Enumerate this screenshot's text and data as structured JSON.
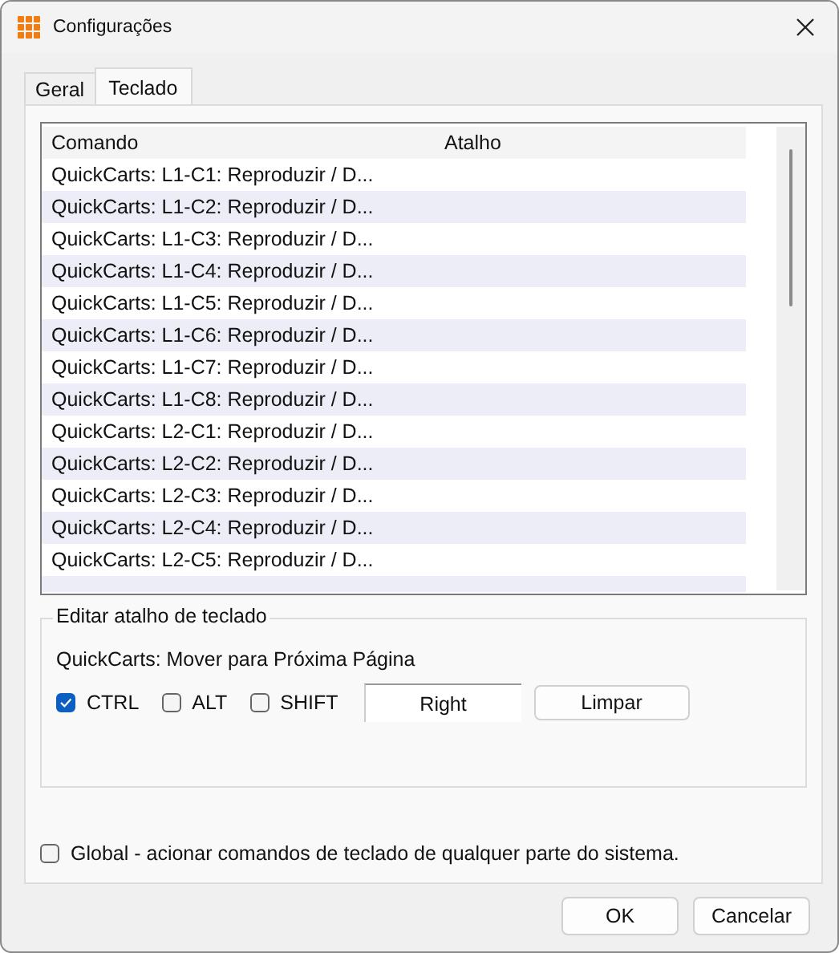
{
  "window": {
    "title": "Configurações"
  },
  "tabs": [
    {
      "label": "Geral",
      "selected": false
    },
    {
      "label": "Teclado",
      "selected": true
    }
  ],
  "table": {
    "columns": [
      "Comando",
      "Atalho"
    ],
    "rows": [
      {
        "command": "QuickCarts: L1-C1: Reproduzir / D..."
      },
      {
        "command": "QuickCarts: L1-C2: Reproduzir / D..."
      },
      {
        "command": "QuickCarts: L1-C3: Reproduzir / D..."
      },
      {
        "command": "QuickCarts: L1-C4: Reproduzir / D..."
      },
      {
        "command": "QuickCarts: L1-C5: Reproduzir / D..."
      },
      {
        "command": "QuickCarts: L1-C6: Reproduzir / D..."
      },
      {
        "command": "QuickCarts: L1-C7: Reproduzir / D..."
      },
      {
        "command": "QuickCarts: L1-C8: Reproduzir / D..."
      },
      {
        "command": "QuickCarts: L2-C1: Reproduzir / D..."
      },
      {
        "command": "QuickCarts: L2-C2: Reproduzir / D..."
      },
      {
        "command": "QuickCarts: L2-C3: Reproduzir / D..."
      },
      {
        "command": "QuickCarts: L2-C4: Reproduzir / D..."
      },
      {
        "command": "QuickCarts: L2-C5: Reproduzir / D..."
      }
    ]
  },
  "editor": {
    "legend": "Editar atalho de teclado",
    "command": "QuickCarts: Mover para Próxima Página",
    "modifiers": [
      {
        "label": "CTRL",
        "checked": true
      },
      {
        "label": "ALT",
        "checked": false
      },
      {
        "label": "SHIFT",
        "checked": false
      }
    ],
    "key": "Right",
    "clear_button": "Limpar"
  },
  "global": {
    "label": "Global - acionar comandos de teclado de qualquer parte do sistema.",
    "checked": false
  },
  "buttons": [
    "OK",
    "Cancelar"
  ]
}
